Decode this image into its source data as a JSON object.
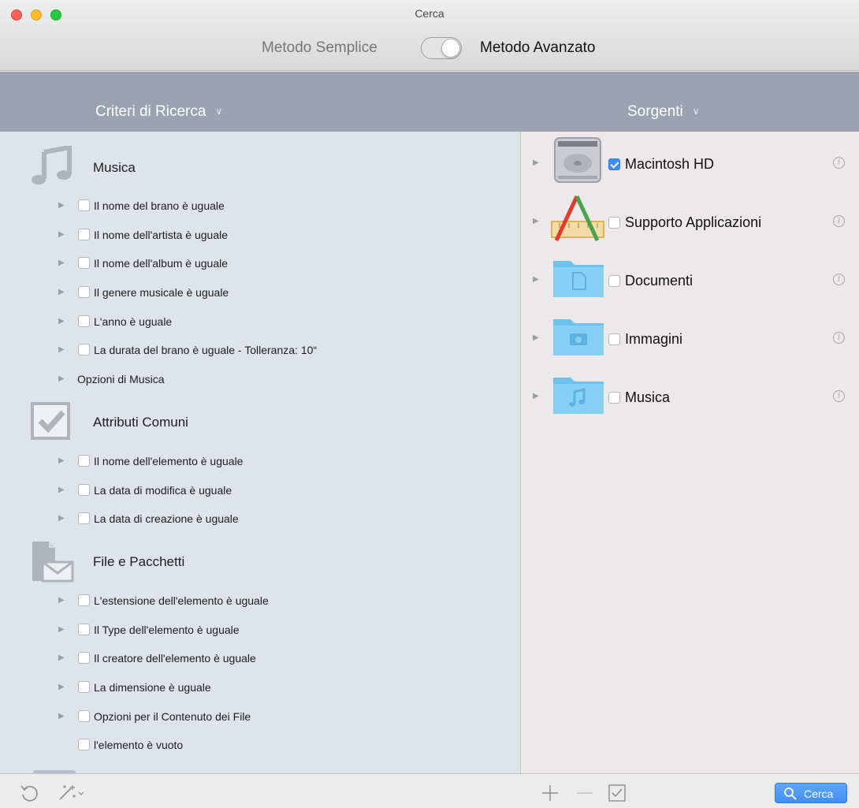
{
  "window": {
    "title": "Cerca",
    "mode_simple_label": "Metodo Semplice",
    "mode_advanced_label": "Metodo Avanzato",
    "mode_toggle_on": true
  },
  "left_header": {
    "label": "Criteri di Ricerca",
    "chevron": "chevron-down-icon"
  },
  "right_header": {
    "label": "Sorgenti",
    "chevron": "chevron-down-icon"
  },
  "criteria": {
    "music": {
      "title": "Musica",
      "icon": "music-note-icon",
      "items": [
        {
          "label": "Il nome del brano è uguale"
        },
        {
          "label": "Il nome dell'artista è uguale"
        },
        {
          "label": "Il nome dell'album è uguale"
        },
        {
          "label": "Il genere musicale è uguale"
        },
        {
          "label": "L'anno è uguale"
        },
        {
          "label": "La durata del brano è uguale - Tolleranza: 10“"
        }
      ],
      "options_label": "Opzioni di Musica"
    },
    "common": {
      "title": "Attributi Comuni",
      "icon": "checkbox-icon",
      "items": [
        {
          "label": "Il nome dell'elemento è uguale"
        },
        {
          "label": "La data di modifica è uguale"
        },
        {
          "label": "La data di creazione è uguale"
        }
      ]
    },
    "files": {
      "title": "File e Pacchetti",
      "icon": "file-envelope-icon",
      "items": [
        {
          "label": "L'estensione dell'elemento è uguale"
        },
        {
          "label": "Il Type dell'elemento è uguale"
        },
        {
          "label": "Il creatore dell'elemento è uguale"
        },
        {
          "label": "La dimensione  è uguale"
        },
        {
          "label": "Opzioni per il Contenuto dei File"
        },
        {
          "label": "l'elemento è vuoto"
        }
      ]
    }
  },
  "sources": [
    {
      "label": "Macintosh HD",
      "checked": true,
      "icon": "hard-drive-icon"
    },
    {
      "label": "Supporto Applicazioni",
      "checked": false,
      "icon": "application-support-icon"
    },
    {
      "label": "Documenti",
      "checked": false,
      "icon": "documents-folder-icon"
    },
    {
      "label": "Immagini",
      "checked": false,
      "icon": "pictures-folder-icon"
    },
    {
      "label": "Musica",
      "checked": false,
      "icon": "music-folder-icon"
    }
  ],
  "bottom_bar": {
    "undo_icon": "undo-icon",
    "magic_icon": "magic-wand-icon",
    "add_icon": "plus-icon",
    "remove_icon": "minus-icon",
    "check_icon": "checkmark-box-icon",
    "search_label": "Cerca",
    "search_icon": "magnifier-icon"
  },
  "colors": {
    "header_band": "#9ba2b2",
    "left_panel": "#dfe3ea",
    "right_panel": "#ede9ea",
    "accent": "#3c8ef7",
    "folder": "#7cc7f2"
  }
}
